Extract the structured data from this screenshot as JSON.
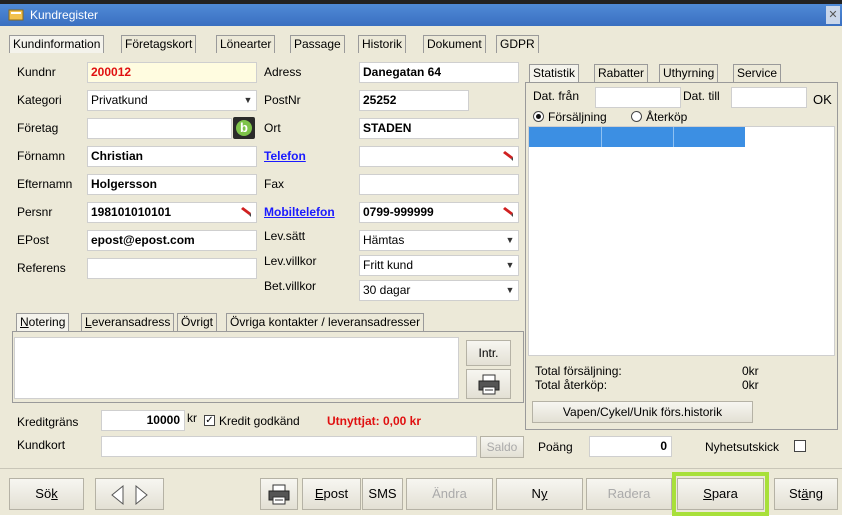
{
  "window": {
    "title": "Kundregister"
  },
  "tabs": [
    "Kundinformation",
    "Företagskort",
    "Lönearter",
    "Passage",
    "Historik",
    "Dokument",
    "GDPR"
  ],
  "form": {
    "kundnr_label": "Kundnr",
    "kundnr": "200012",
    "kategori_label": "Kategori",
    "kategori": "Privatkund",
    "foretag_label": "Företag",
    "foretag": "",
    "fornamn_label": "Förnamn",
    "fornamn": "Christian",
    "efternamn_label": "Efternamn",
    "efternamn": "Holgersson",
    "persnr_label": "Persnr",
    "persnr": "198101010101",
    "epost_label": "EPost",
    "epost": "epost@epost.com",
    "referens_label": "Referens",
    "referens": "",
    "adress_label": "Adress",
    "adress": "Danegatan 64",
    "postnr_label": "PostNr",
    "postnr": "25252",
    "ort_label": "Ort",
    "ort": "STADEN",
    "telefon_label": "Telefon",
    "telefon": "",
    "fax_label": "Fax",
    "fax": "",
    "mobil_label": "Mobiltelefon",
    "mobil": "0799-999999",
    "levsatt_label": "Lev.sätt",
    "levsatt": "Hämtas",
    "levvillkor_label": "Lev.villkor",
    "levvillkor": "Fritt kund",
    "betvillkor_label": "Bet.villkor",
    "betvillkor": "30 dagar"
  },
  "notes": {
    "tabs": [
      "Notering",
      "Leveransadress",
      "Övrigt",
      "Övriga kontakter / leveransadresser"
    ],
    "intr_label": "Intr."
  },
  "stats": {
    "tabs": [
      "Statistik",
      "Rabatter",
      "Uthyrning",
      "Service"
    ],
    "dat_fran_label": "Dat. från",
    "dat_fran": "",
    "dat_till_label": "Dat. till",
    "dat_till": "",
    "ok_label": "OK",
    "radio_forsaljning": "Försäljning",
    "radio_aterkop": "Återköp",
    "total_forsaljning_label": "Total försäljning:",
    "total_forsaljning": "0kr",
    "total_aterkop_label": "Total återköp:",
    "total_aterkop": "0kr",
    "history_button": "Vapen/Cykel/Unik förs.historik"
  },
  "credit": {
    "kreditgrans_label": "Kreditgräns",
    "kreditgrans": "10000",
    "currency": "kr",
    "kredit_godkand_label": "Kredit godkänd",
    "utnyttjat": "Utnyttjat: 0,00 kr"
  },
  "kundkort": {
    "label": "Kundkort",
    "value": "",
    "saldo_label": "Saldo"
  },
  "poang": {
    "label": "Poäng",
    "value": "0"
  },
  "nyhetsutskick_label": "Nyhetsutskick",
  "toolbar": {
    "sok": "Sök",
    "epost": "Epost",
    "sms": "SMS",
    "andra": "Ändra",
    "ny": "Ny",
    "radera": "Radera",
    "spara": "Spara",
    "stang": "Stäng"
  },
  "colors": {
    "highlight": "#a8e03a",
    "title_bar": "#3a6fc0",
    "selection": "#3c8fe3",
    "link": "#1a1aff",
    "warning": "#e01010"
  }
}
